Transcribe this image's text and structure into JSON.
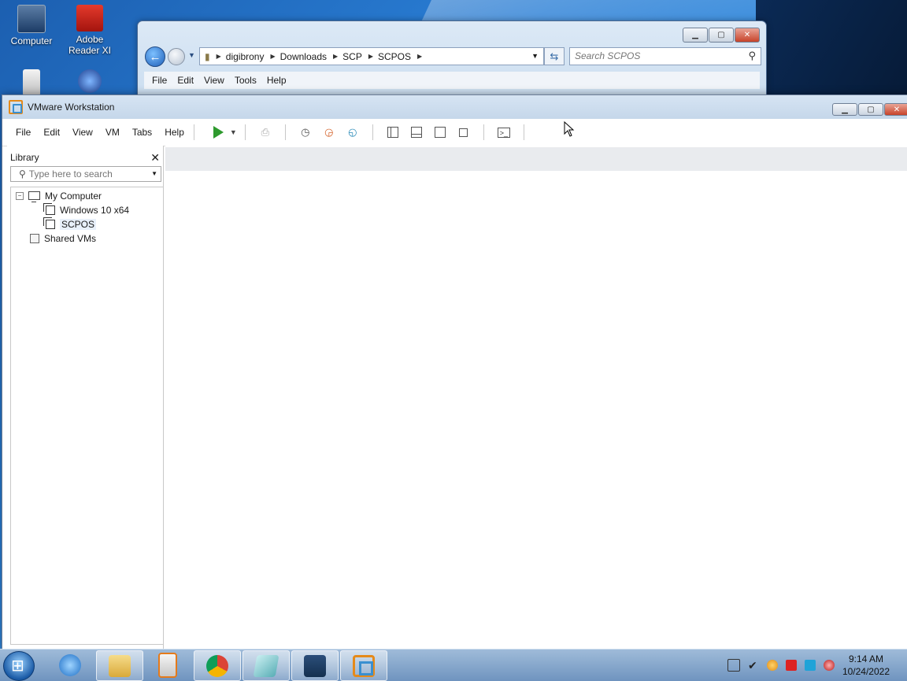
{
  "desktop": {
    "icons": [
      {
        "label": "Computer"
      },
      {
        "label": "Adobe\nReader XI"
      }
    ]
  },
  "explorer": {
    "breadcrumb": [
      "digibrony",
      "Downloads",
      "SCP",
      "SCPOS"
    ],
    "search_placeholder": "Search SCPOS",
    "menu": [
      "File",
      "Edit",
      "View",
      "Tools",
      "Help"
    ]
  },
  "vmware": {
    "title": "VMware Workstation",
    "menu": [
      "File",
      "Edit",
      "View",
      "VM",
      "Tabs",
      "Help"
    ],
    "library": {
      "title": "Library",
      "search_placeholder": "Type here to search",
      "tree": {
        "root": "My Computer",
        "vms": [
          "Windows 10 x64",
          "SCPOS"
        ],
        "shared": "Shared VMs"
      }
    }
  },
  "taskbar": {
    "clock_time": "9:14 AM",
    "clock_date": "10/24/2022"
  },
  "colors": {
    "accent": "#1f5fb8",
    "vmware_orange": "#e58a1a",
    "play_green": "#2e9a2e"
  }
}
